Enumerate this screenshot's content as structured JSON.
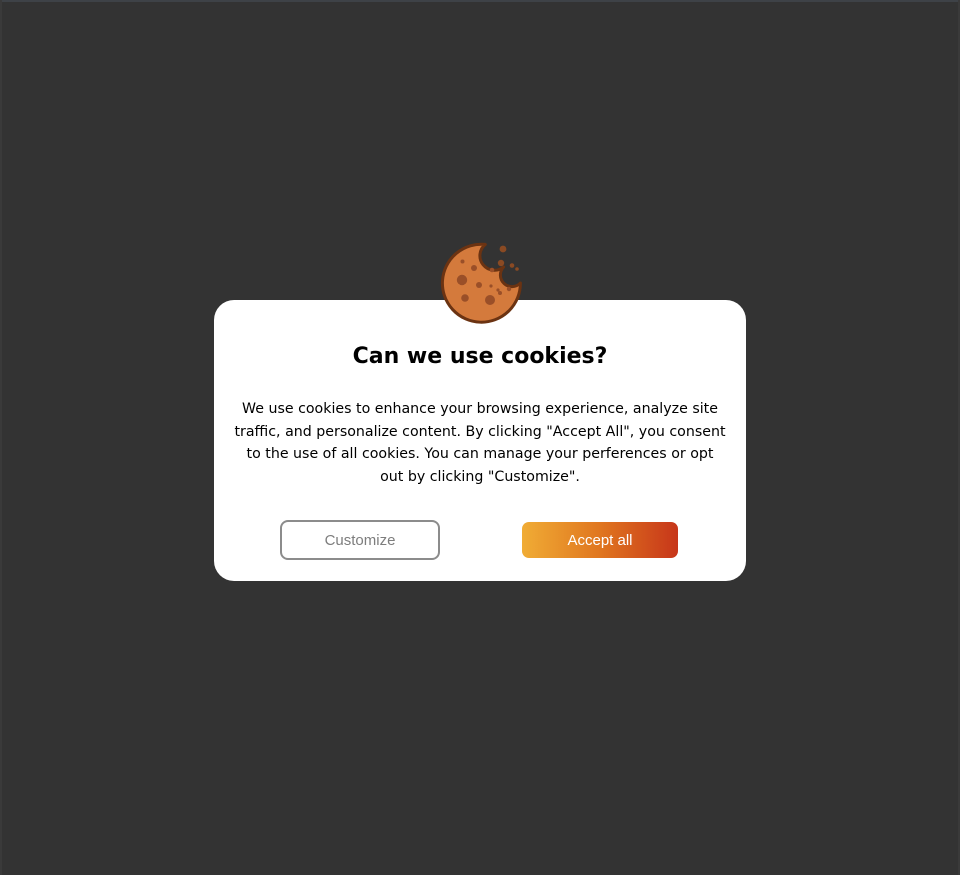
{
  "dialog": {
    "title": "Can we use cookies?",
    "message": "We use cookies to enhance your browsing experience, analyze site traffic, and personalize content. By clicking \"Accept All\", you consent to the use of all cookies. You can manage your perferences or opt out by clicking \"Customize\".",
    "icon": "cookie-icon",
    "buttons": {
      "customize_label": "Customize",
      "accept_label": "Accept all"
    }
  },
  "colors": {
    "background": "#333333",
    "dialog": "#ffffff",
    "cookie_fill": "#d47a3c",
    "cookie_outline": "#6b3312",
    "accent_gradient_start": "#f0ac35",
    "accent_gradient_end": "#c7361a",
    "customize_border": "#8c8c8c"
  }
}
